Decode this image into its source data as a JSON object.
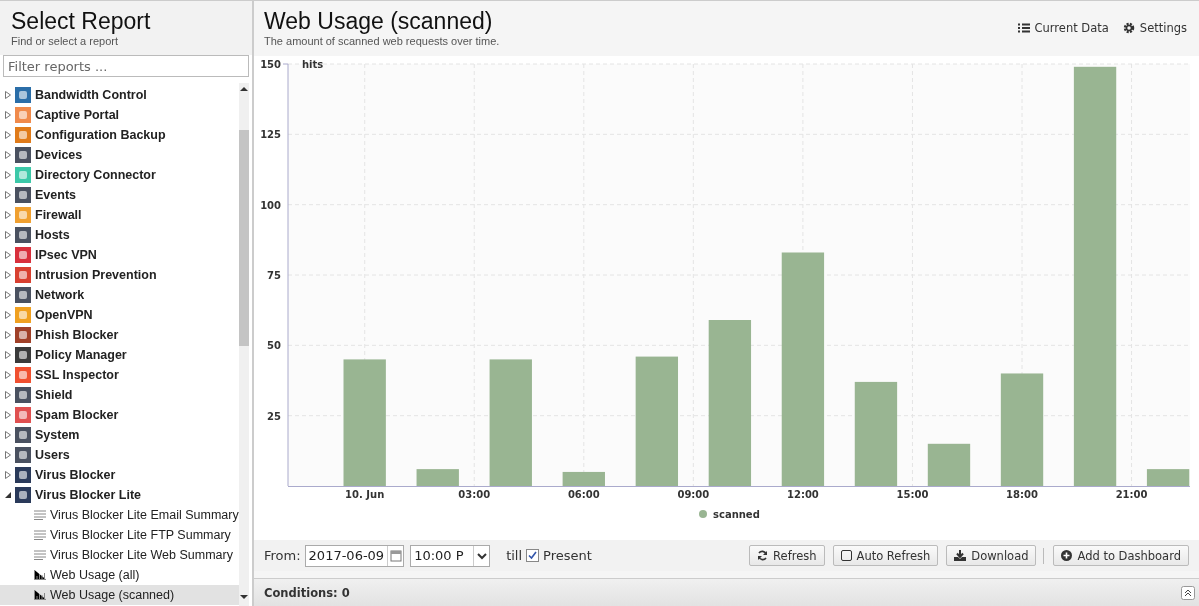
{
  "sidebar": {
    "title": "Select Report",
    "subtitle": "Find or select a report",
    "filter": {
      "placeholder": "Filter reports ..."
    },
    "items": [
      {
        "label": "Bandwidth Control",
        "expanded": false,
        "color": "#2b6ea8"
      },
      {
        "label": "Captive Portal",
        "expanded": false,
        "color": "#f08a4b"
      },
      {
        "label": "Configuration Backup",
        "expanded": false,
        "color": "#e07b1a"
      },
      {
        "label": "Devices",
        "expanded": false,
        "color": "#4a5160"
      },
      {
        "label": "Directory Connector",
        "expanded": false,
        "color": "#3cc8a8"
      },
      {
        "label": "Events",
        "expanded": false,
        "color": "#4a5160"
      },
      {
        "label": "Firewall",
        "expanded": false,
        "color": "#f0a030"
      },
      {
        "label": "Hosts",
        "expanded": false,
        "color": "#4a5160"
      },
      {
        "label": "IPsec VPN",
        "expanded": false,
        "color": "#d8303c"
      },
      {
        "label": "Intrusion Prevention",
        "expanded": false,
        "color": "#d84030"
      },
      {
        "label": "Network",
        "expanded": false,
        "color": "#4a5160"
      },
      {
        "label": "OpenVPN",
        "expanded": false,
        "color": "#f0a020"
      },
      {
        "label": "Phish Blocker",
        "expanded": false,
        "color": "#a04028"
      },
      {
        "label": "Policy Manager",
        "expanded": false,
        "color": "#3a3a3a"
      },
      {
        "label": "SSL Inspector",
        "expanded": false,
        "color": "#f05030"
      },
      {
        "label": "Shield",
        "expanded": false,
        "color": "#4a5160"
      },
      {
        "label": "Spam Blocker",
        "expanded": false,
        "color": "#e05050"
      },
      {
        "label": "System",
        "expanded": false,
        "color": "#4a5160"
      },
      {
        "label": "Users",
        "expanded": false,
        "color": "#4a5160"
      },
      {
        "label": "Virus Blocker",
        "expanded": false,
        "color": "#2a3a5a"
      },
      {
        "label": "Virus Blocker Lite",
        "expanded": true,
        "color": "#2a3a5a",
        "children": [
          {
            "label": "Virus Blocker Lite Email Summary",
            "kind": "text",
            "selected": false
          },
          {
            "label": "Virus Blocker Lite FTP Summary",
            "kind": "text",
            "selected": false
          },
          {
            "label": "Virus Blocker Lite Web Summary",
            "kind": "text",
            "selected": false
          },
          {
            "label": "Web Usage (all)",
            "kind": "chart",
            "selected": false
          },
          {
            "label": "Web Usage (scanned)",
            "kind": "chart",
            "selected": true
          }
        ]
      }
    ]
  },
  "report": {
    "title": "Web Usage (scanned)",
    "description": "The amount of scanned web requests over time.",
    "actions": [
      {
        "label": "Current Data",
        "kind": "list"
      },
      {
        "label": "Settings",
        "kind": "gear"
      }
    ],
    "chart_data": {
      "type": "bar",
      "ylabel": "hits",
      "x": [
        0,
        2,
        4,
        6,
        8,
        10,
        12,
        14,
        16,
        18,
        20,
        22
      ],
      "series": [
        {
          "name": "scanned",
          "color": "#99b592",
          "values": [
            45,
            6,
            45,
            5,
            46,
            59,
            83,
            37,
            15,
            40,
            149,
            6
          ]
        }
      ],
      "grid": true,
      "xlim": [
        -2.1,
        22.6
      ],
      "ylim": [
        0,
        150
      ],
      "xticks": [
        {
          "value": 0,
          "label": "10. Jun"
        },
        {
          "value": 3,
          "label": "03:00"
        },
        {
          "value": 6,
          "label": "06:00"
        },
        {
          "value": 9,
          "label": "09:00"
        },
        {
          "value": 12,
          "label": "12:00"
        },
        {
          "value": 15,
          "label": "15:00"
        },
        {
          "value": 18,
          "label": "18:00"
        },
        {
          "value": 21,
          "label": "21:00"
        }
      ],
      "yticks": [
        25,
        50,
        75,
        100,
        125,
        150
      ]
    },
    "toolbar": {
      "from_label": "From:",
      "date": "2017-06-09",
      "time": "10:00 P",
      "till_label": "till",
      "present": {
        "label": "Present",
        "checked": true
      },
      "buttons": [
        {
          "label": "Refresh",
          "kind": "refresh"
        },
        {
          "label": "Auto Refresh",
          "kind": "toggle",
          "checked": false
        },
        {
          "label": "Download",
          "kind": "download"
        },
        {
          "label": "Add to Dashboard",
          "kind": "add"
        }
      ]
    },
    "conditions": {
      "label": "Conditions: 0"
    }
  }
}
